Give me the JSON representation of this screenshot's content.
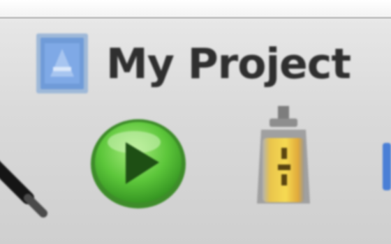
{
  "window": {
    "project_name": "My Project"
  },
  "toolbar": {
    "items": [
      {
        "name": "pencil-icon"
      },
      {
        "name": "play-icon",
        "color": "#5cc63a"
      },
      {
        "name": "lock-icon",
        "color": "#f2c12e"
      }
    ]
  },
  "colors": {
    "toolbar_bg": "#d9d9d9",
    "text": "#2f2f2f",
    "run_green": "#5cc63a",
    "lock_yellow": "#f2c12e",
    "accent_blue": "#4a7fd6"
  }
}
